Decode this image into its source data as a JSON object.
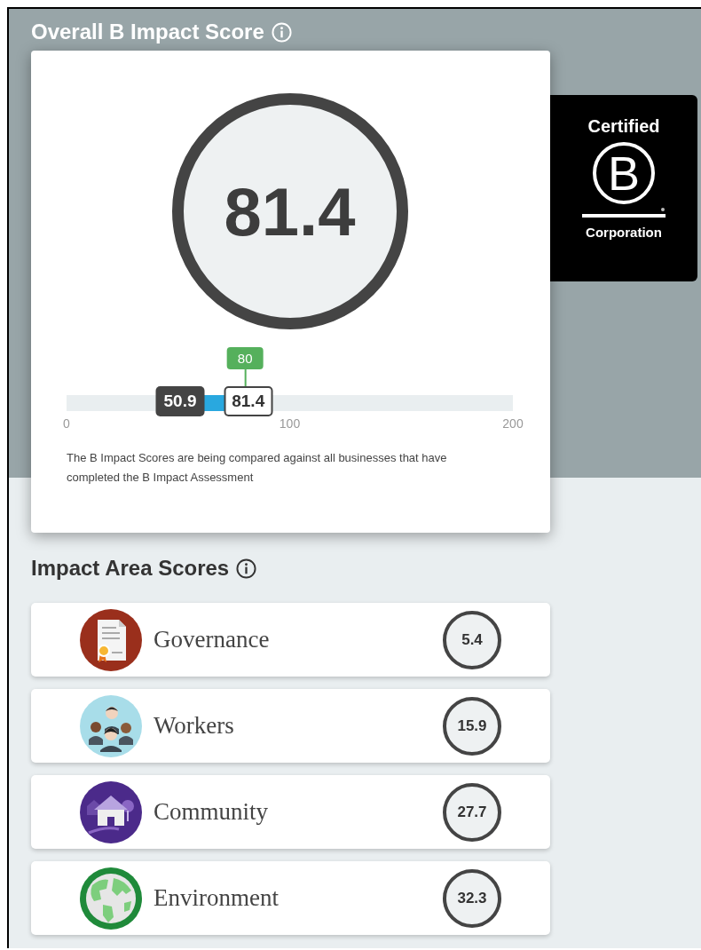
{
  "header": {
    "title": "Overall B Impact Score"
  },
  "overall": {
    "score": "81.4"
  },
  "comparison": {
    "ticks": [
      "0",
      "100",
      "200"
    ],
    "median": "50.9",
    "score": "81.4",
    "threshold": "80"
  },
  "note": "The B Impact Scores are being compared against all businesses that have completed the B Impact Assessment",
  "badge": {
    "top": "Certified",
    "letter": "B",
    "bottom": "Corporation"
  },
  "impact": {
    "title": "Impact Area Scores",
    "areas": [
      {
        "kind": "governance",
        "name": "Governance",
        "score": "5.4"
      },
      {
        "kind": "workers",
        "name": "Workers",
        "score": "15.9"
      },
      {
        "kind": "community",
        "name": "Community",
        "score": "27.7"
      },
      {
        "kind": "environment",
        "name": "Environment",
        "score": "32.3"
      }
    ]
  }
}
